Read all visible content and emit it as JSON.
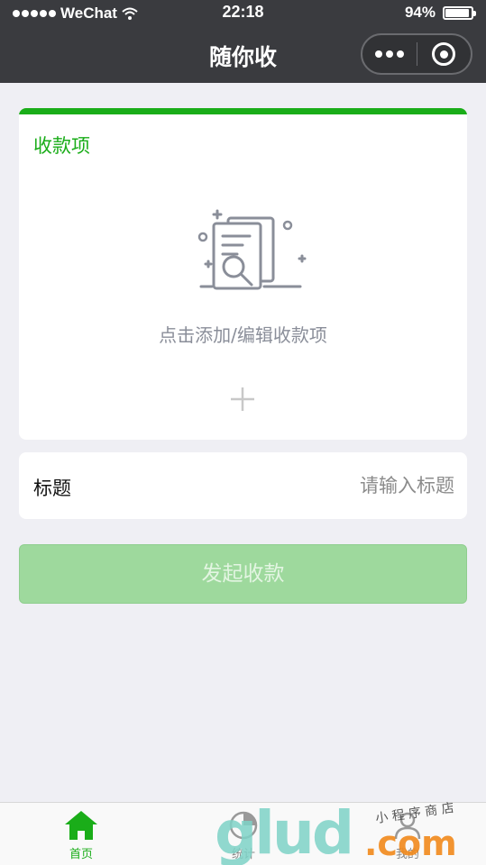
{
  "status_bar": {
    "carrier": "WeChat",
    "time": "22:18",
    "battery_percent": "94%",
    "battery_level": 0.94
  },
  "nav": {
    "title": "随你收"
  },
  "card": {
    "title": "收款项",
    "hint": "点击添加/编辑收款项",
    "accent_color": "#1aad19"
  },
  "title_field": {
    "label": "标题",
    "placeholder": "请输入标题",
    "value": ""
  },
  "submit": {
    "label": "发起收款",
    "state": "disabled",
    "color": "#9ed99d"
  },
  "tab_bar": {
    "items": [
      {
        "label": "首页",
        "icon": "home-icon",
        "active": true
      },
      {
        "label": "统计",
        "icon": "stats-icon",
        "active": false
      },
      {
        "label": "我的",
        "icon": "user-icon",
        "active": false
      }
    ]
  },
  "watermark": {
    "main": "glud",
    "suffix": ".com",
    "small": "小 程 序 商 店"
  }
}
